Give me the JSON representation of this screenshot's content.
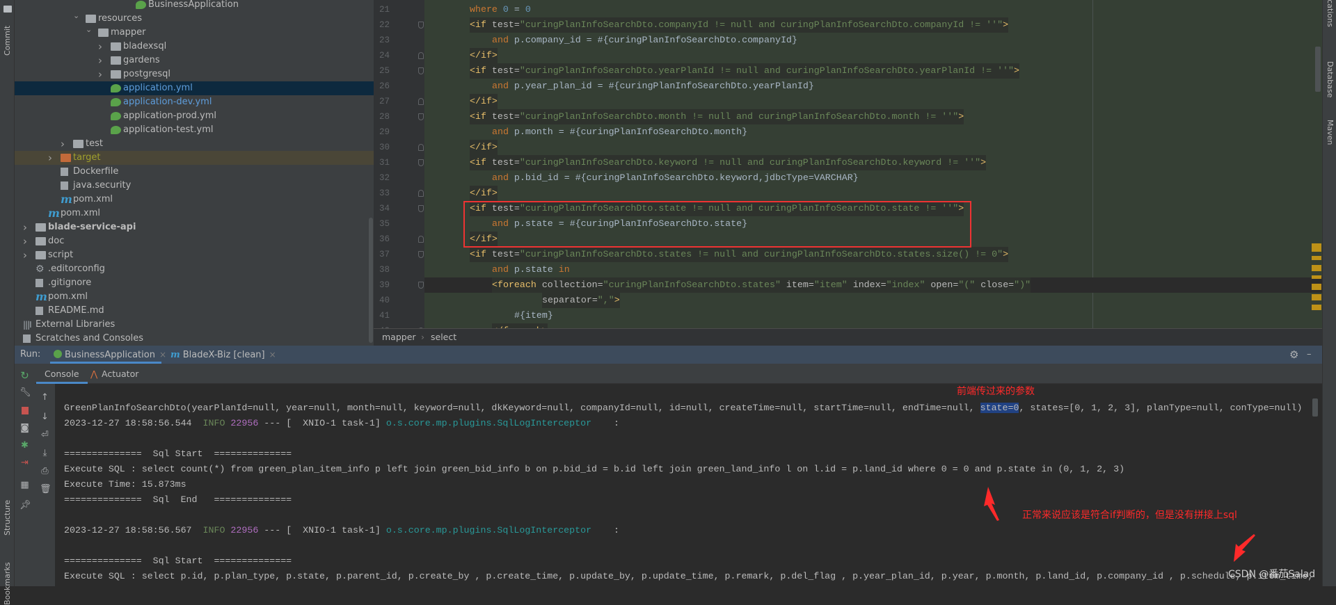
{
  "left_strip": {
    "commit": "Commit",
    "structure": "Structure",
    "bookmarks": "Bookmarks"
  },
  "right_strip": {
    "notifications": "Notifications",
    "database": "Database",
    "maven": "Maven"
  },
  "tree": [
    {
      "label": "BusinessApplication",
      "depth": 10,
      "icon": "spring-boot-class-icon",
      "chevron": ""
    },
    {
      "label": "resources",
      "depth": 6,
      "icon": "resources-folder-icon",
      "chevron": "expanded"
    },
    {
      "label": "mapper",
      "depth": 7,
      "icon": "folder-icon",
      "chevron": "expanded"
    },
    {
      "label": "bladexsql",
      "depth": 8,
      "icon": "folder-icon",
      "chevron": "collapsed"
    },
    {
      "label": "gardens",
      "depth": 8,
      "icon": "folder-icon",
      "chevron": "collapsed"
    },
    {
      "label": "postgresql",
      "depth": 8,
      "icon": "folder-icon",
      "chevron": "collapsed"
    },
    {
      "label": "application.yml",
      "depth": 8,
      "icon": "spring-yml-icon",
      "chevron": "",
      "selected": true,
      "color": "#5e9ddb"
    },
    {
      "label": "application-dev.yml",
      "depth": 8,
      "icon": "spring-yml-icon",
      "chevron": "",
      "color": "#5e9ddb"
    },
    {
      "label": "application-prod.yml",
      "depth": 8,
      "icon": "spring-yml-icon",
      "chevron": ""
    },
    {
      "label": "application-test.yml",
      "depth": 8,
      "icon": "spring-yml-icon",
      "chevron": ""
    },
    {
      "label": "test",
      "depth": 5,
      "icon": "folder-icon",
      "chevron": "collapsed"
    },
    {
      "label": "target",
      "depth": 4,
      "icon": "excluded-folder-icon",
      "chevron": "collapsed",
      "ignored": true,
      "color": "#a0a02c"
    },
    {
      "label": "Dockerfile",
      "depth": 4,
      "icon": "docker-file-icon",
      "chevron": ""
    },
    {
      "label": "java.security",
      "depth": 4,
      "icon": "text-file-icon",
      "chevron": ""
    },
    {
      "label": "pom.xml",
      "depth": 4,
      "icon": "maven-icon",
      "chevron": ""
    },
    {
      "label": "pom.xml",
      "depth": 3,
      "icon": "maven-icon",
      "chevron": ""
    },
    {
      "label": "blade-service-api",
      "depth": 2,
      "icon": "module-folder-icon",
      "chevron": "collapsed",
      "bold": true
    },
    {
      "label": "doc",
      "depth": 2,
      "icon": "folder-icon",
      "chevron": "collapsed"
    },
    {
      "label": "script",
      "depth": 2,
      "icon": "folder-icon",
      "chevron": "collapsed"
    },
    {
      "label": ".editorconfig",
      "depth": 2,
      "icon": "gear-icon",
      "chevron": ""
    },
    {
      "label": ".gitignore",
      "depth": 2,
      "icon": "ignore-file-icon",
      "chevron": ""
    },
    {
      "label": "pom.xml",
      "depth": 2,
      "icon": "maven-icon",
      "chevron": ""
    },
    {
      "label": "README.md",
      "depth": 2,
      "icon": "markdown-file-icon",
      "chevron": ""
    },
    {
      "label": "External Libraries",
      "depth": 1,
      "icon": "libraries-icon",
      "chevron": "collapsed"
    },
    {
      "label": "Scratches and Consoles",
      "depth": 1,
      "icon": "scratches-icon",
      "chevron": ""
    }
  ],
  "editor": {
    "lines": [
      {
        "n": "21",
        "indent": "",
        "segs": [
          {
            "t": "where",
            "c": "kw"
          },
          {
            "t": " ",
            "c": "txt"
          },
          {
            "t": "0",
            "c": "num"
          },
          {
            "t": " = ",
            "c": "txt"
          },
          {
            "t": "0",
            "c": "num"
          }
        ]
      },
      {
        "n": "22",
        "fold": "start",
        "tagbg": true,
        "indent": "",
        "segs": [
          {
            "t": "<if",
            "c": "tag"
          },
          {
            "t": " test=",
            "c": "attr"
          },
          {
            "t": "\"curingPlanInfoSearchDto.companyId != null and curingPlanInfoSearchDto.companyId != ''\"",
            "c": "str"
          },
          {
            "t": ">",
            "c": "tag"
          }
        ]
      },
      {
        "n": "23",
        "indent": "    ",
        "segs": [
          {
            "t": "and",
            "c": "kw"
          },
          {
            "t": " p.company_id = #{curingPlanInfoSearchDto.companyId}",
            "c": "txt"
          }
        ]
      },
      {
        "n": "24",
        "fold": "end",
        "tagbg": true,
        "indent": "",
        "segs": [
          {
            "t": "</if>",
            "c": "tag"
          }
        ]
      },
      {
        "n": "25",
        "fold": "start",
        "tagbg": true,
        "indent": "",
        "segs": [
          {
            "t": "<if",
            "c": "tag"
          },
          {
            "t": " test=",
            "c": "attr"
          },
          {
            "t": "\"curingPlanInfoSearchDto.yearPlanId != null and curingPlanInfoSearchDto.yearPlanId != ''\"",
            "c": "str"
          },
          {
            "t": ">",
            "c": "tag"
          }
        ]
      },
      {
        "n": "26",
        "indent": "    ",
        "segs": [
          {
            "t": "and",
            "c": "kw"
          },
          {
            "t": " p.year_plan_id = #{curingPlanInfoSearchDto.yearPlanId}",
            "c": "txt"
          }
        ]
      },
      {
        "n": "27",
        "fold": "end",
        "tagbg": true,
        "indent": "",
        "segs": [
          {
            "t": "</if>",
            "c": "tag"
          }
        ]
      },
      {
        "n": "28",
        "fold": "start",
        "tagbg": true,
        "indent": "",
        "segs": [
          {
            "t": "<if",
            "c": "tag"
          },
          {
            "t": " test=",
            "c": "attr"
          },
          {
            "t": "\"curingPlanInfoSearchDto.month != null and curingPlanInfoSearchDto.month != ''\"",
            "c": "str"
          },
          {
            "t": ">",
            "c": "tag"
          }
        ]
      },
      {
        "n": "29",
        "indent": "    ",
        "segs": [
          {
            "t": "and",
            "c": "kw"
          },
          {
            "t": " p.month = #{curingPlanInfoSearchDto.month}",
            "c": "txt"
          }
        ]
      },
      {
        "n": "30",
        "fold": "end",
        "tagbg": true,
        "indent": "",
        "segs": [
          {
            "t": "</if>",
            "c": "tag"
          }
        ]
      },
      {
        "n": "31",
        "fold": "start",
        "tagbg": true,
        "indent": "",
        "segs": [
          {
            "t": "<if",
            "c": "tag"
          },
          {
            "t": " test=",
            "c": "attr"
          },
          {
            "t": "\"curingPlanInfoSearchDto.keyword != null and curingPlanInfoSearchDto.keyword != ''\"",
            "c": "str"
          },
          {
            "t": ">",
            "c": "tag"
          }
        ]
      },
      {
        "n": "32",
        "indent": "    ",
        "segs": [
          {
            "t": "and",
            "c": "kw"
          },
          {
            "t": " p.bid_id = #{curingPlanInfoSearchDto.keyword,jdbcType=VARCHAR}",
            "c": "txt"
          }
        ]
      },
      {
        "n": "33",
        "fold": "end",
        "tagbg": true,
        "indent": "",
        "segs": [
          {
            "t": "</if>",
            "c": "tag"
          }
        ]
      },
      {
        "n": "34",
        "fold": "start",
        "tagbg": true,
        "indent": "",
        "segs": [
          {
            "t": "<if",
            "c": "tag"
          },
          {
            "t": " test=",
            "c": "attr"
          },
          {
            "t": "\"curingPlanInfoSearchDto.state != null and curingPlanInfoSearchDto.state != ''\"",
            "c": "str"
          },
          {
            "t": ">",
            "c": "tag"
          }
        ]
      },
      {
        "n": "35",
        "indent": "    ",
        "segs": [
          {
            "t": "and",
            "c": "kw"
          },
          {
            "t": " p.state = #{curingPlanInfoSearchDto.state}",
            "c": "txt"
          }
        ]
      },
      {
        "n": "36",
        "fold": "end",
        "tagbg": true,
        "indent": "",
        "segs": [
          {
            "t": "</if>",
            "c": "tag"
          }
        ]
      },
      {
        "n": "37",
        "fold": "start",
        "tagbg": true,
        "indent": "",
        "segs": [
          {
            "t": "<if",
            "c": "tag"
          },
          {
            "t": " test=",
            "c": "attr"
          },
          {
            "t": "\"curingPlanInfoSearchDto.states != null and curingPlanInfoSearchDto.states.size() != 0\"",
            "c": "str"
          },
          {
            "t": ">",
            "c": "tag"
          }
        ]
      },
      {
        "n": "38",
        "indent": "    ",
        "segs": [
          {
            "t": "and",
            "c": "kw"
          },
          {
            "t": " p.state ",
            "c": "txt"
          },
          {
            "t": "in",
            "c": "kw"
          }
        ]
      },
      {
        "n": "39",
        "fold": "start",
        "tagbg": true,
        "caret": true,
        "indent": "    ",
        "segs": [
          {
            "t": "<foreach",
            "c": "tag"
          },
          {
            "t": " collection=",
            "c": "attr"
          },
          {
            "t": "\"curingPlanInfoSearchDto.states\"",
            "c": "str"
          },
          {
            "t": " item=",
            "c": "attr"
          },
          {
            "t": "\"item\"",
            "c": "str"
          },
          {
            "t": " index=",
            "c": "attr"
          },
          {
            "t": "\"index\"",
            "c": "str"
          },
          {
            "t": " open=",
            "c": "attr"
          },
          {
            "t": "\"(\"",
            "c": "str"
          },
          {
            "t": " close=",
            "c": "attr"
          },
          {
            "t": "\")\"",
            "c": "str"
          }
        ]
      },
      {
        "n": "40",
        "tagbg": true,
        "indent": "             ",
        "segs": [
          {
            "t": "separator=",
            "c": "attr"
          },
          {
            "t": "\",\"",
            "c": "str"
          },
          {
            "t": ">",
            "c": "tag"
          }
        ]
      },
      {
        "n": "41",
        "indent": "        ",
        "segs": [
          {
            "t": "#{item}",
            "c": "txt"
          }
        ]
      },
      {
        "n": "42",
        "fold": "end",
        "tagbg": true,
        "indent": "    ",
        "segs": [
          {
            "t": "</foreach>",
            "c": "tag"
          }
        ]
      }
    ]
  },
  "breadcrumb": {
    "items": [
      "mapper",
      "select"
    ],
    "separator": "›"
  },
  "run": {
    "label": "Run:",
    "tabs": [
      {
        "label": "BusinessApplication",
        "icon": "spring-boot-icon",
        "active": true
      },
      {
        "label": "BladeX-Biz [clean]",
        "icon": "maven-icon"
      }
    ],
    "close": "×",
    "subtabs": [
      {
        "label": "Console",
        "active": true
      },
      {
        "label": "Actuator"
      }
    ]
  },
  "console": {
    "lines": [
      [
        {
          "t": "GreenPlanInfoSearchDto(yearPlanId=null, year=null, month=null, keyword=null, dkKeyword=null, companyId=null, id=null, createTime=null, startTime=null, endTime=null, ",
          "c": ""
        },
        {
          "t": "state=0",
          "c": "hl"
        },
        {
          "t": ", states=[0, 1, 2, 3], planType=null, conType=null)",
          "c": ""
        }
      ],
      [
        {
          "t": "2023-12-27 18:58:56.544  ",
          "c": ""
        },
        {
          "t": "INFO",
          "c": "info"
        },
        {
          "t": " ",
          "c": ""
        },
        {
          "t": "22956",
          "c": "pid"
        },
        {
          "t": " --- [  XNIO-1 task-1] ",
          "c": ""
        },
        {
          "t": "o.s.core.mp.plugins.SqlLogInterceptor",
          "c": "logger"
        },
        {
          "t": "    :",
          "c": ""
        }
      ],
      [],
      [
        {
          "t": "==============  Sql Start  ==============",
          "c": ""
        }
      ],
      [
        {
          "t": "Execute SQL : select count(*) from green_plan_item_info p left join green_bid_info b on p.bid_id = b.id left join green_land_info l on l.id = p.land_id where 0 = 0 and p.state in (0, 1, 2, 3)",
          "c": ""
        }
      ],
      [
        {
          "t": "Execute Time: 15.873ms",
          "c": ""
        }
      ],
      [
        {
          "t": "==============  Sql  End   ==============",
          "c": ""
        }
      ],
      [],
      [
        {
          "t": "2023-12-27 18:58:56.567  ",
          "c": ""
        },
        {
          "t": "INFO",
          "c": "info"
        },
        {
          "t": " ",
          "c": ""
        },
        {
          "t": "22956",
          "c": "pid"
        },
        {
          "t": " --- [  XNIO-1 task-1] ",
          "c": ""
        },
        {
          "t": "o.s.core.mp.plugins.SqlLogInterceptor",
          "c": "logger"
        },
        {
          "t": "    :",
          "c": ""
        }
      ],
      [],
      [
        {
          "t": "==============  Sql Start  ==============",
          "c": ""
        }
      ],
      [
        {
          "t": "Execute SQL : select p.id, p.plan_type, p.state, p.parent_id, p.create_by , p.create_time, p.update_by, p.update_time, p.remark, p.del_flag , p.year_plan_id, p.year, p.month, p.land_id, p.company_id , p.schedule, p.item_time,",
          "c": ""
        }
      ]
    ]
  },
  "annotations": {
    "params_note": "前端传过来的参数",
    "issue_note": "正常来说应该是符合if判断的，但是没有拼接上sql",
    "color": "#ff2a2a"
  },
  "watermark": "CSDN @番茄Salad"
}
